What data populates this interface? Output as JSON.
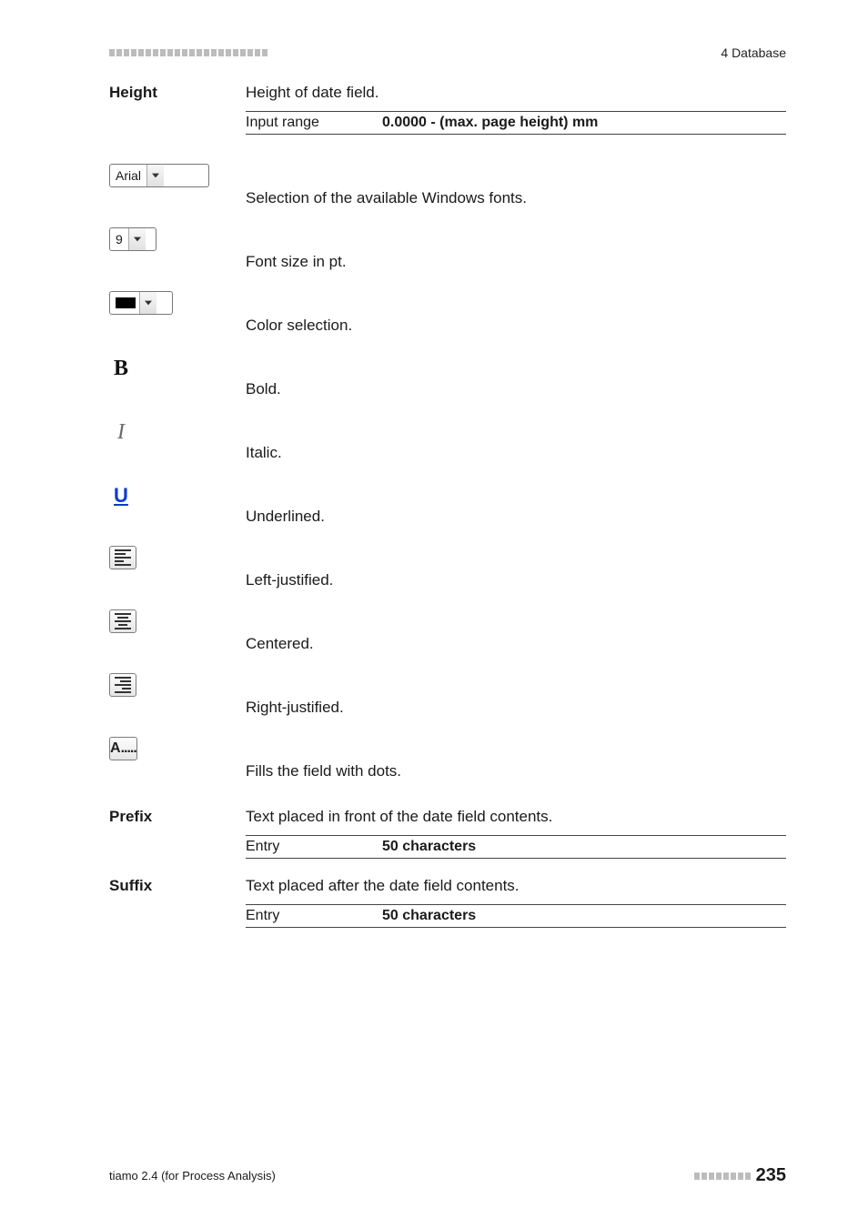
{
  "header": {
    "right": "4 Database"
  },
  "height": {
    "label": "Height",
    "desc": "Height of date field.",
    "spec_key": "Input range",
    "spec_val": "0.0000 - (max. page height) mm"
  },
  "font_dd": {
    "value": "Arial",
    "desc": "Selection of the available Windows fonts."
  },
  "size_dd": {
    "value": "9",
    "desc": "Font size in pt."
  },
  "color_dd": {
    "desc": "Color selection."
  },
  "bold": {
    "glyph": "B",
    "desc": "Bold."
  },
  "italic": {
    "glyph": "I",
    "desc": "Italic."
  },
  "underline": {
    "glyph": "U",
    "desc": "Underlined."
  },
  "align_left": {
    "desc": "Left-justified."
  },
  "align_center": {
    "desc": "Centered."
  },
  "align_right": {
    "desc": "Right-justified."
  },
  "fill_dots": {
    "glyph": "A",
    "desc": "Fills the field with dots."
  },
  "prefix": {
    "label": "Prefix",
    "desc": "Text placed in front of the date field contents.",
    "spec_key": "Entry",
    "spec_val": "50 characters"
  },
  "suffix": {
    "label": "Suffix",
    "desc": "Text placed after the date field contents.",
    "spec_key": "Entry",
    "spec_val": "50 characters"
  },
  "footer": {
    "left": "tiamo 2.4 (for Process Analysis)",
    "page": "235"
  }
}
